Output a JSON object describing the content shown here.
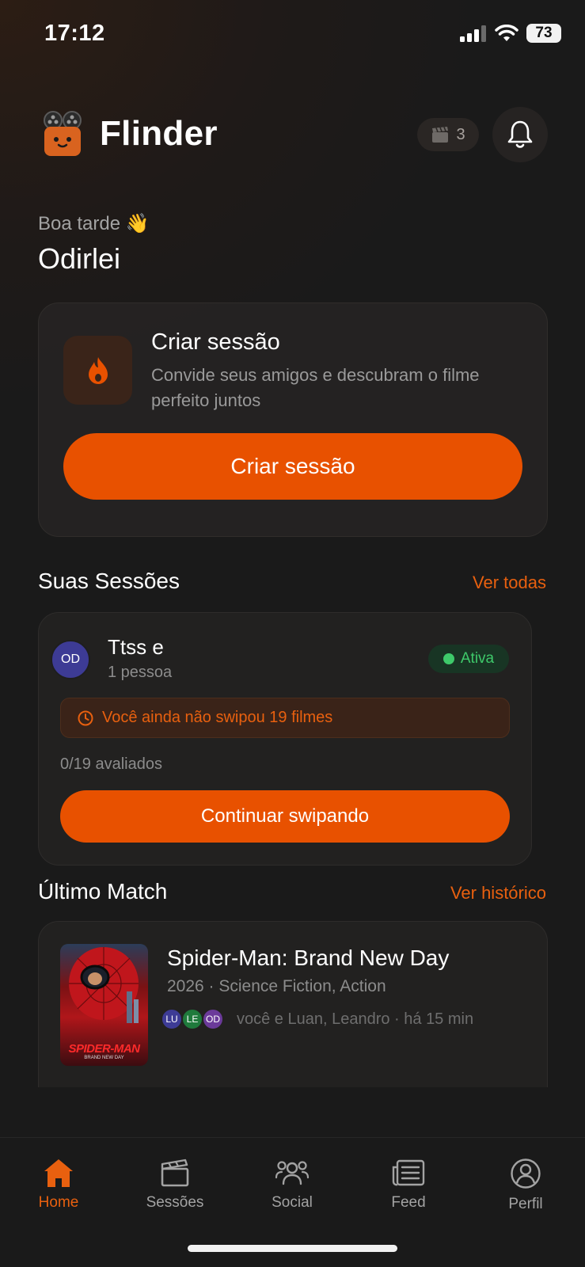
{
  "status_bar": {
    "time": "17:12",
    "battery": "73"
  },
  "header": {
    "title": "Flinder",
    "session_count": "3"
  },
  "greeting": {
    "text": "Boa tarde 👋",
    "name": "Odirlei"
  },
  "create_card": {
    "title": "Criar sessão",
    "description": "Convide seus amigos e descubram o filme perfeito juntos",
    "button_label": "Criar sessão"
  },
  "sessions_section": {
    "title": "Suas Sessões",
    "link": "Ver todas",
    "session": {
      "avatar": "OD",
      "name": "Ttss e",
      "people": "1 pessoa",
      "status": "Ativa",
      "warning": "Você ainda não swipou 19 filmes",
      "progress": "0/19 avaliados",
      "button_label": "Continuar swipando"
    }
  },
  "match_section": {
    "title": "Último Match",
    "link": "Ver histórico",
    "movie": {
      "title": "Spider-Man: Brand New Day",
      "meta": "2026 · Science Fiction, Action",
      "poster_title": "SPIDER-MAN",
      "poster_subtitle": "BRAND NEW DAY",
      "avatars": [
        "LU",
        "LE",
        "OD"
      ],
      "people": "você e Luan, Leandro · há 15 min"
    }
  },
  "tabs": [
    {
      "label": "Home",
      "icon": "home-icon",
      "active": true
    },
    {
      "label": "Sessões",
      "icon": "clapperboard-icon",
      "active": false
    },
    {
      "label": "Social",
      "icon": "users-icon",
      "active": false
    },
    {
      "label": "Feed",
      "icon": "newspaper-icon",
      "active": false
    },
    {
      "label": "Perfil",
      "icon": "profile-icon",
      "active": false
    }
  ],
  "colors": {
    "accent": "#e85100",
    "success": "#3ec96a",
    "background": "#1a1a1a"
  }
}
